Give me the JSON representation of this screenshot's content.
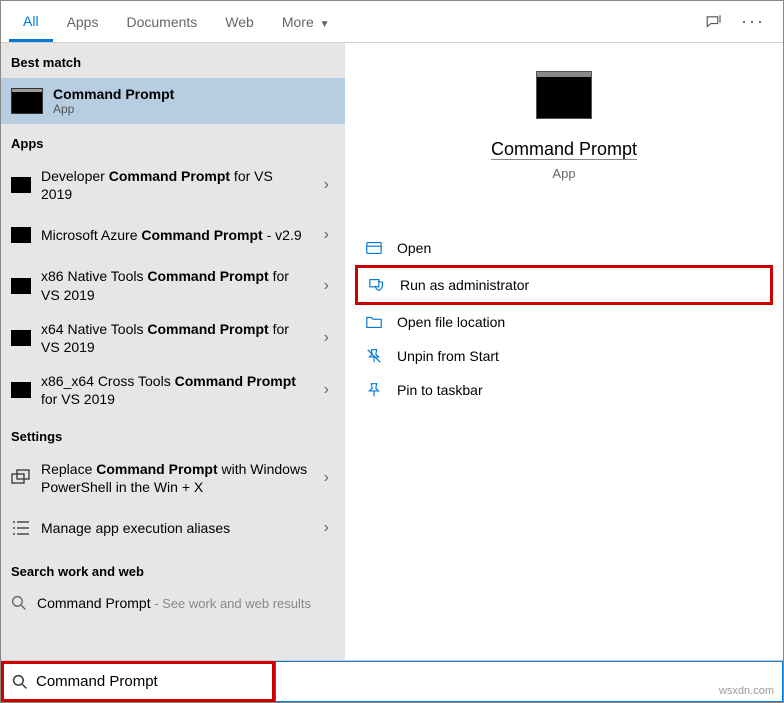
{
  "tabs": {
    "all": "All",
    "apps": "Apps",
    "documents": "Documents",
    "web": "Web",
    "more": "More"
  },
  "sections": {
    "best_match": "Best match",
    "apps": "Apps",
    "settings": "Settings",
    "search_work_web": "Search work and web"
  },
  "best_match": {
    "title": "Command Prompt",
    "subtitle": "App"
  },
  "apps_list": [
    {
      "prefix": "Developer ",
      "bold": "Command Prompt",
      "suffix": " for VS 2019"
    },
    {
      "prefix": "Microsoft Azure ",
      "bold": "Command Prompt",
      "suffix": " - v2.9"
    },
    {
      "prefix": "x86 Native Tools ",
      "bold": "Command Prompt",
      "suffix": " for VS 2019"
    },
    {
      "prefix": "x64 Native Tools ",
      "bold": "Command Prompt",
      "suffix": " for VS 2019"
    },
    {
      "prefix": "x86_x64 Cross Tools ",
      "bold": "Command Prompt",
      "suffix": " for VS 2019"
    }
  ],
  "settings_list": [
    {
      "prefix": "Replace ",
      "bold": "Command Prompt",
      "suffix": " with Windows PowerShell in the Win + X"
    },
    {
      "prefix": "Manage app execution aliases",
      "bold": "",
      "suffix": ""
    }
  ],
  "web_result": {
    "bold": "Command Prompt",
    "sub": " - See work and web results"
  },
  "preview": {
    "title": "Command Prompt",
    "subtitle": "App"
  },
  "actions": {
    "open": "Open",
    "run_admin": "Run as administrator",
    "open_location": "Open file location",
    "unpin_start": "Unpin from Start",
    "pin_taskbar": "Pin to taskbar"
  },
  "search": {
    "value": "Command Prompt"
  },
  "watermark": "wsxdn.com"
}
